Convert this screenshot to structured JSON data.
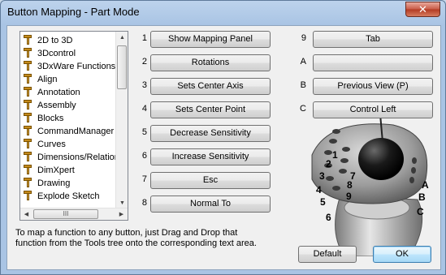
{
  "window": {
    "title": "Button Mapping - Part Mode",
    "close_glyph": "✕"
  },
  "tree": {
    "items": [
      "2D to 3D",
      "3Dcontrol",
      "3DxWare Functions",
      "Align",
      "Annotation",
      "Assembly",
      "Blocks",
      "CommandManager",
      "Curves",
      "Dimensions/Relations",
      "DimXpert",
      "Drawing",
      "Explode Sketch"
    ],
    "icon": "hammer-icon",
    "scroll_up": "▲",
    "scroll_down": "▼",
    "scroll_left": "◀",
    "scroll_right": "▶",
    "hthumb_grip": "III"
  },
  "left_buttons": [
    {
      "num": "1",
      "label": "Show Mapping Panel"
    },
    {
      "num": "2",
      "label": "Rotations"
    },
    {
      "num": "3",
      "label": "Sets Center Axis"
    },
    {
      "num": "4",
      "label": "Sets Center Point"
    },
    {
      "num": "5",
      "label": "Decrease Sensitivity"
    },
    {
      "num": "6",
      "label": "Increase Sensitivity"
    },
    {
      "num": "7",
      "label": "Esc"
    },
    {
      "num": "8",
      "label": "Normal To"
    }
  ],
  "right_buttons": [
    {
      "num": "9",
      "label": "Tab"
    },
    {
      "num": "A",
      "label": ""
    },
    {
      "num": "B",
      "label": "Previous View    (P)"
    },
    {
      "num": "C",
      "label": "Control Left"
    }
  ],
  "device_labels": [
    "1",
    "2",
    "3",
    "7",
    "8",
    "4",
    "5",
    "9",
    "6",
    "A",
    "B",
    "C"
  ],
  "hint": "To map a function to any button, just Drag and Drop that function from the Tools tree onto the corresponding text area.",
  "footer": {
    "default_label": "Default",
    "ok_label": "OK"
  },
  "colors": {
    "accent": "#3c7fb1",
    "close": "#c85a46"
  }
}
